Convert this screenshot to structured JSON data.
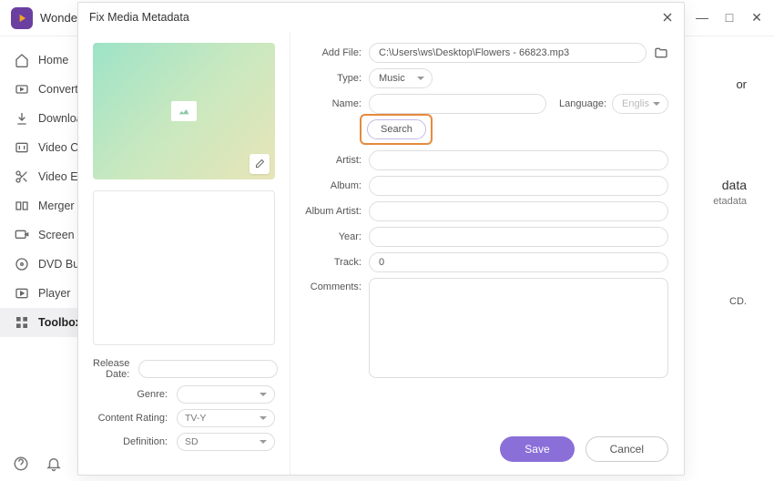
{
  "app": {
    "title": "Wonder"
  },
  "window_controls": {
    "min": "—",
    "max": "□",
    "close": "✕"
  },
  "sidebar": {
    "items": [
      {
        "label": "Home"
      },
      {
        "label": "Converter"
      },
      {
        "label": "Downloader"
      },
      {
        "label": "Video Compressor"
      },
      {
        "label": "Video Editor"
      },
      {
        "label": "Merger"
      },
      {
        "label": "Screen Recorder"
      },
      {
        "label": "DVD Burner"
      },
      {
        "label": "Player"
      },
      {
        "label": "Toolbox"
      }
    ]
  },
  "modal": {
    "title": "Fix Media Metadata",
    "addfile_label": "Add File:",
    "addfile_value": "C:\\Users\\ws\\Desktop\\Flowers - 66823.mp3",
    "type_label": "Type:",
    "type_value": "Music",
    "name_label": "Name:",
    "name_value": "",
    "language_label": "Language:",
    "language_value": "English",
    "search_btn": "Search",
    "artist_label": "Artist:",
    "artist_value": "",
    "album_label": "Album:",
    "album_value": "",
    "albumartist_label": "Album Artist:",
    "albumartist_value": "",
    "year_label": "Year:",
    "year_value": "",
    "track_label": "Track:",
    "track_value": "0",
    "comments_label": "Comments:",
    "comments_value": "",
    "releasedate_label": "Release Date:",
    "releasedate_value": "",
    "genre_label": "Genre:",
    "genre_value": "",
    "contentrating_label": "Content Rating:",
    "contentrating_value": "TV-Y",
    "definition_label": "Definition:",
    "definition_value": "SD",
    "save_btn": "Save",
    "cancel_btn": "Cancel"
  },
  "bg": {
    "t1": "or",
    "t2": "data",
    "t3": "etadata",
    "t4": "CD."
  }
}
